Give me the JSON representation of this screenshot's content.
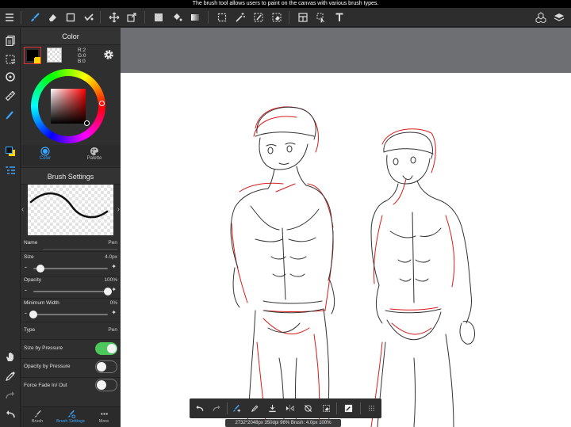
{
  "status_message": "The brush tool allows users to paint on the canvas with various brush types.",
  "color_panel": {
    "title": "Color",
    "r": "R:2",
    "g": "G:0",
    "b": "B:0",
    "main_color": "#020000",
    "tabs": [
      {
        "label": "Color"
      },
      {
        "label": "Palette"
      }
    ]
  },
  "brush_settings": {
    "title": "Brush Settings",
    "name_label": "Name",
    "name_value": "Pen",
    "size_label": "Size",
    "size_value": "4.0px",
    "size_level": 0.1,
    "opacity_label": "Opacity",
    "opacity_value": "100%",
    "opacity_level": 1.0,
    "min_width_label": "Minimum Width",
    "min_width_value": "0%",
    "min_width_level": 0.0,
    "type_label": "Type",
    "type_value": "Pen",
    "size_by_pressure_label": "Size by Pressure",
    "size_by_pressure_on": true,
    "opacity_by_pressure_label": "Opacity by Pressure",
    "opacity_by_pressure_on": false,
    "force_fade_label": "Force Fade In/ Out",
    "force_fade_on": false
  },
  "bottom_tabs": [
    {
      "label": "Brush"
    },
    {
      "label": "Brush Settings"
    },
    {
      "label": "More"
    }
  ],
  "info_bar": "2732*2048px 350dpi 96% Brush: 4.0px 100%",
  "colors": {
    "accent": "#3aa7ff",
    "toggle_on": "#4cc75b",
    "sketch_red": "#d91c1c",
    "sketch_gray": "#333333"
  }
}
